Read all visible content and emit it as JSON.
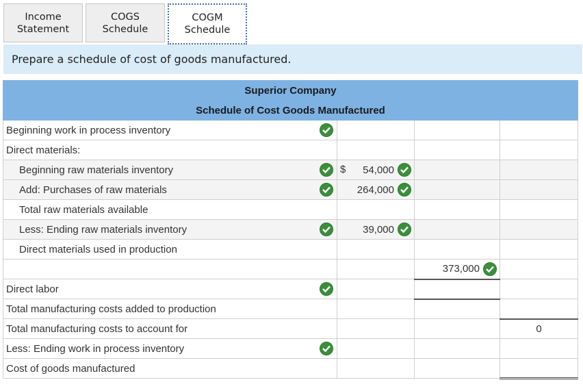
{
  "tabs": [
    {
      "line1": "Income",
      "line2": "Statement"
    },
    {
      "line1": "COGS",
      "line2": "Schedule"
    },
    {
      "line1": "COGM",
      "line2": "Schedule"
    }
  ],
  "prompt": "Prepare a schedule of cost of goods manufactured.",
  "table": {
    "company": "Superior Company",
    "title": "Schedule of Cost Goods Manufactured",
    "rows": {
      "beginning_wip": "Beginning work in process inventory",
      "direct_materials": "Direct materials:",
      "beginning_raw": "Beginning raw materials inventory",
      "purchases": "Add: Purchases of raw materials",
      "total_raw": "Total raw materials available",
      "ending_raw": "Less: Ending raw materials inventory",
      "dm_used": "Direct materials used in production",
      "direct_labor": "Direct labor",
      "total_added": "Total manufacturing costs added to production",
      "total_account": "Total manufacturing costs to account for",
      "ending_wip": "Less: Ending work in process inventory",
      "cogm": "Cost of goods manufactured"
    },
    "values": {
      "dollar_sign": "$",
      "beginning_raw": "54,000",
      "purchases": "264,000",
      "ending_raw": "39,000",
      "subtotal": "373,000",
      "total_account": "0"
    }
  },
  "icons": {
    "check": "check-circle-icon",
    "check_color": "#3b8f3b"
  }
}
